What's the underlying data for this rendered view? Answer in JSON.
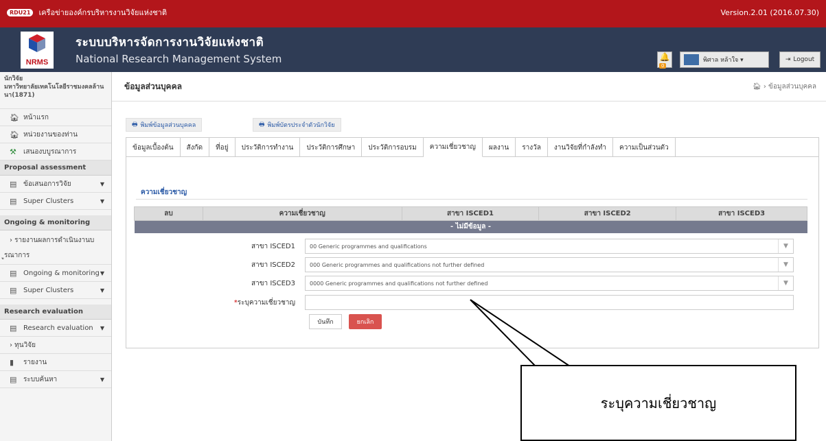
{
  "topbar": {
    "badge": "RDU21",
    "title": "เครือข่ายองค์กรบริหารงานวิจัยแห่งชาติ",
    "version": "Version.2.01 (2016.07.30)"
  },
  "header": {
    "title_th": "ระบบบริหารจัดการงานวิจัยแห่งชาติ",
    "title_en": "National Research Management System",
    "logo_text": "NRMS",
    "notif_count": "0",
    "user_name": "พิศาล หล้าใจ ▾",
    "logout": "Logout"
  },
  "sidebar": {
    "role": "นักวิจัย",
    "org": "มหาวิทยาลัยเทคโนโลยีราชมงคลล้านนา(1871)",
    "items_top": [
      "หน้าแรก",
      "หน่วยงานของท่าน",
      "เสนองบบูรณาการ"
    ],
    "sec1": "Proposal assessment",
    "items1": [
      "ข้อเสนอการวิจัย",
      "Super Clusters"
    ],
    "sec2": "Ongoing & monitoring",
    "item_report_a": "› รายงานผลการดำเนินงานบ",
    "item_report_b": "ูรณาการ",
    "items2": [
      "Ongoing & monitoring",
      "Super Clusters"
    ],
    "sec3": "Research evaluation",
    "items3": [
      "Research evaluation",
      "› ทุนวิจัย",
      "รายงาน",
      "ระบบค้นหา"
    ]
  },
  "page": {
    "title": "ข้อมูลส่วนบุคคล",
    "breadcrumb": "ข้อมูลส่วนบุคคล",
    "print_personal": "พิมพ์ข้อมูลส่วนบุคคล",
    "print_card": "พิมพ์บัตรประจำตัวนักวิจัย"
  },
  "tabs": [
    "ข้อมูลเบื้องต้น",
    "สังกัด",
    "ที่อยู่",
    "ประวัติการทำงาน",
    "ประวัติการศึกษา",
    "ประวัติการอบรม",
    "ความเชี่ยวชาญ",
    "ผลงาน",
    "รางวัล",
    "งานวิจัยที่กำลังทำ",
    "ความเป็นส่วนตัว"
  ],
  "section": {
    "title": "ความเชี่ยวชาญ"
  },
  "table": {
    "headers": [
      "ลบ",
      "ความเชี่ยวชาญ",
      "สาขา ISCED1",
      "สาขา ISCED2",
      "สาขา ISCED3"
    ],
    "empty": "- ไม่มีข้อมูล -"
  },
  "form": {
    "isced1_label": "สาขา ISCED1",
    "isced1_value": "00 Generic programmes and qualifications",
    "isced2_label": "สาขา ISCED2",
    "isced2_value": "000 Generic programmes and qualifications not further defined",
    "isced3_label": "สาขา ISCED3",
    "isced3_value": "0000 Generic programmes and qualifications not further defined",
    "expertise_label": "ระบุความเชี่ยวชาญ",
    "expertise_value": "",
    "save": "บันทึก",
    "cancel": "ยกเลิก"
  },
  "callout": "ระบุความเชี่ยวชาญ"
}
